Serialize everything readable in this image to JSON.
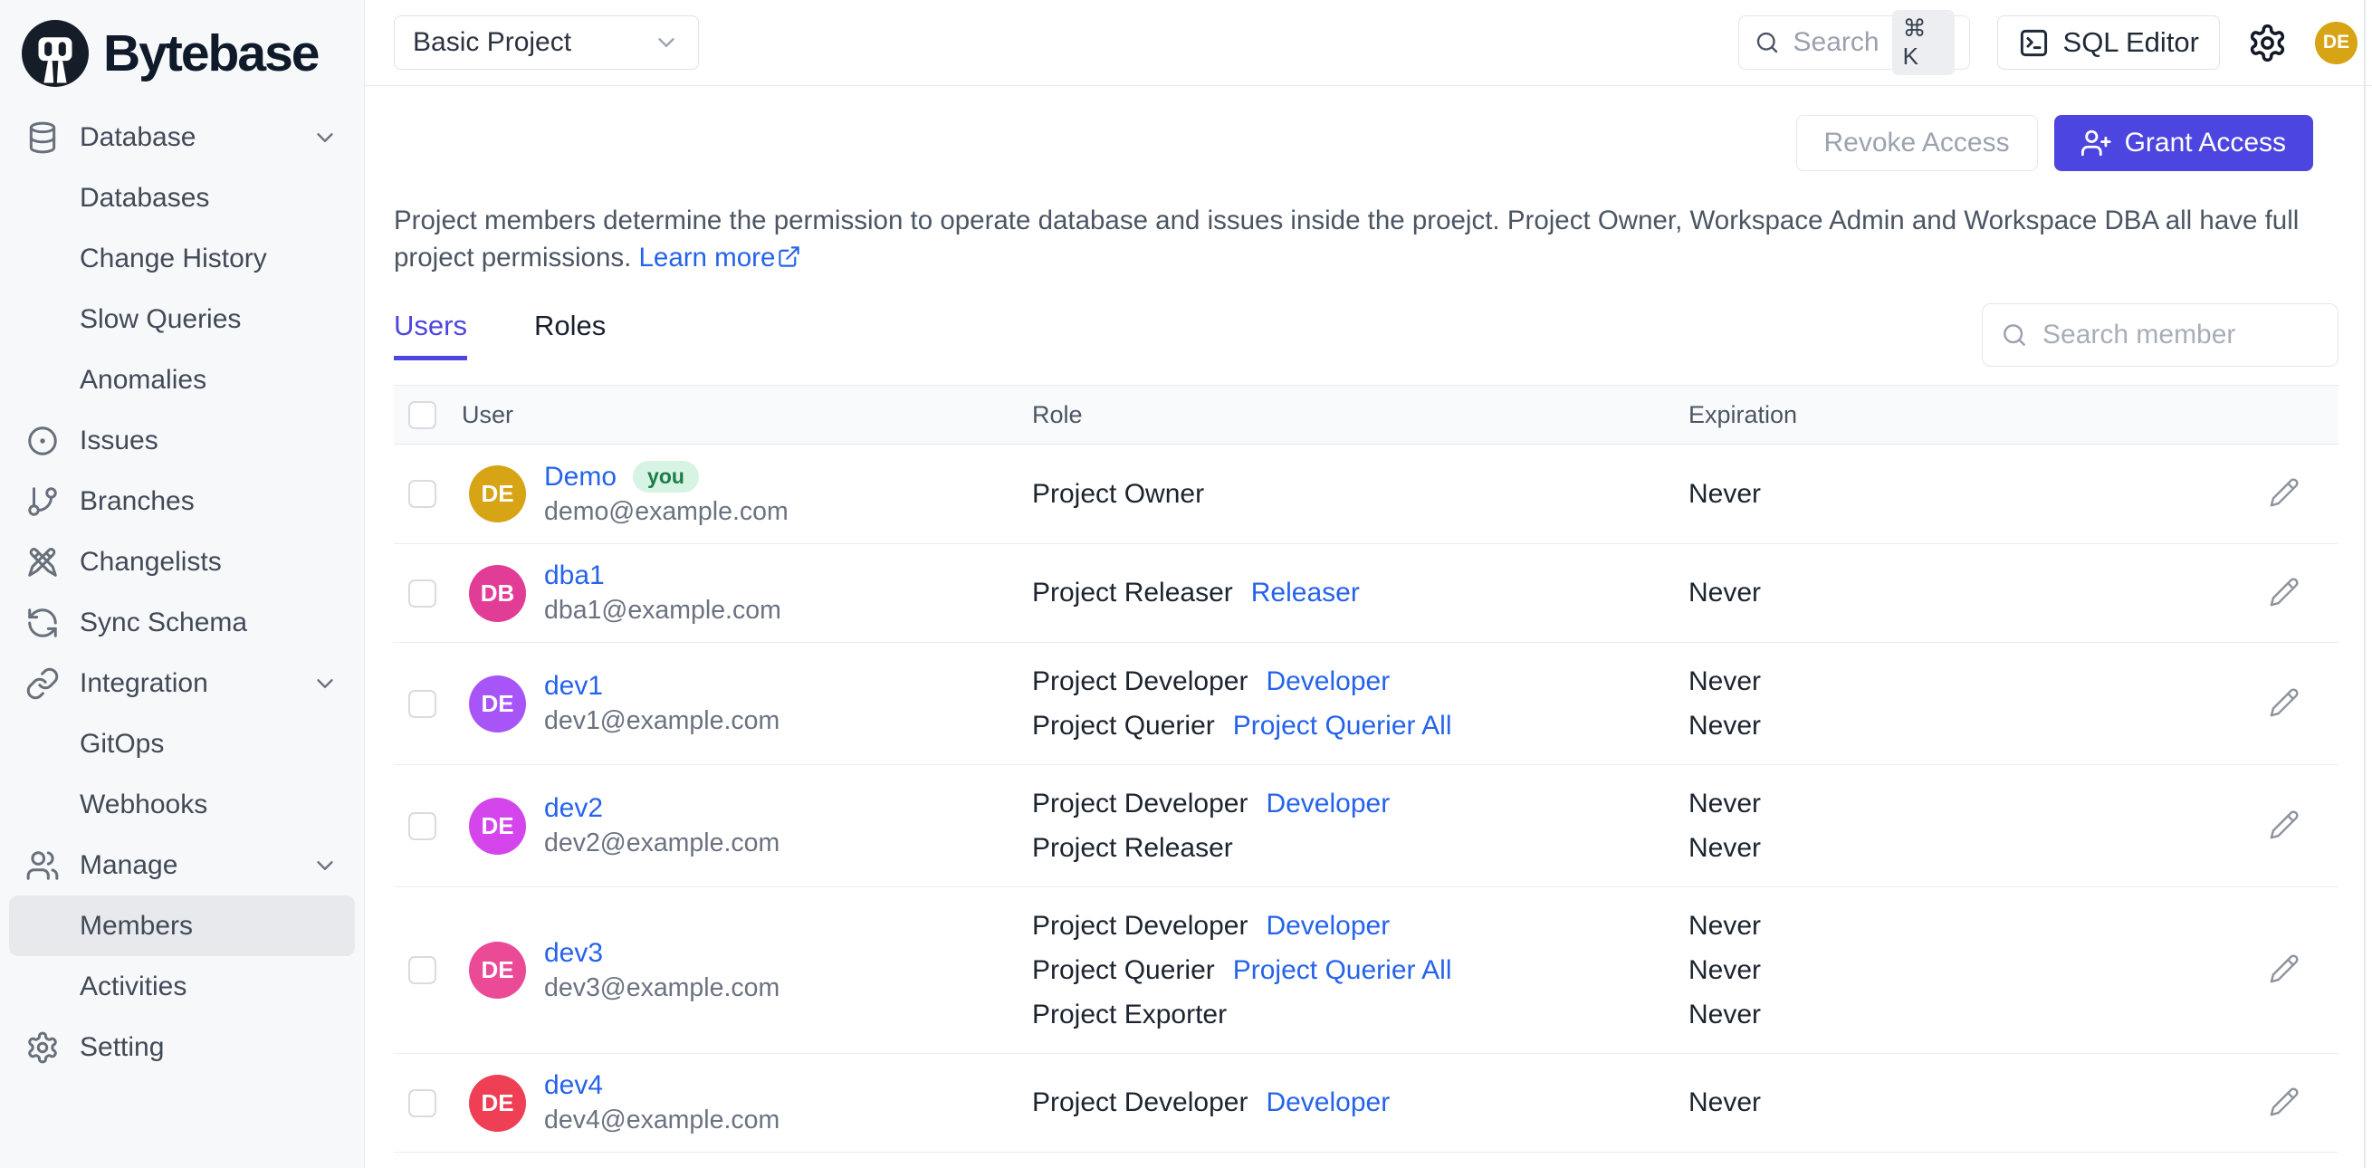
{
  "app": {
    "name": "Bytebase"
  },
  "colors": {
    "accent_indigo": "#4D45E0",
    "link_blue": "#2563eb",
    "topbar_avatar": "#D6A415",
    "sidebar_bg": "#f7f8fa",
    "badge_green_bg": "#d6f3e4",
    "badge_green_text": "#1b7d47"
  },
  "topbar": {
    "project_selector": "Basic Project",
    "search_placeholder": "Search",
    "search_shortcut": "⌘ K",
    "sql_editor_label": "SQL Editor",
    "avatar_initials": "DE"
  },
  "sidebar": {
    "items": [
      {
        "label": "Database",
        "icon": "database",
        "type": "group",
        "chevron": true
      },
      {
        "label": "Databases",
        "type": "sub"
      },
      {
        "label": "Change History",
        "type": "sub"
      },
      {
        "label": "Slow Queries",
        "type": "sub"
      },
      {
        "label": "Anomalies",
        "type": "sub"
      },
      {
        "label": "Issues",
        "icon": "issues",
        "type": "top"
      },
      {
        "label": "Branches",
        "icon": "branch",
        "type": "top"
      },
      {
        "label": "Changelists",
        "icon": "changelist",
        "type": "top"
      },
      {
        "label": "Sync Schema",
        "icon": "sync",
        "type": "top"
      },
      {
        "label": "Integration",
        "icon": "link",
        "type": "group",
        "chevron": true
      },
      {
        "label": "GitOps",
        "type": "sub"
      },
      {
        "label": "Webhooks",
        "type": "sub"
      },
      {
        "label": "Manage",
        "icon": "users",
        "type": "group",
        "chevron": true
      },
      {
        "label": "Members",
        "type": "sub",
        "active": true
      },
      {
        "label": "Activities",
        "type": "sub"
      },
      {
        "label": "Setting",
        "icon": "gear",
        "type": "top"
      }
    ]
  },
  "page": {
    "revoke_button": "Revoke Access",
    "grant_button": "Grant Access",
    "description": "Project members determine the permission to operate database and issues inside the proejct. Project Owner, Workspace Admin and Workspace DBA all have full project permissions. ",
    "learn_more": "Learn more",
    "tabs": [
      {
        "label": "Users",
        "active": true
      },
      {
        "label": "Roles",
        "active": false
      }
    ],
    "member_search_placeholder": "Search member",
    "table": {
      "columns": [
        "User",
        "Role",
        "Expiration"
      ],
      "rows": [
        {
          "name": "Demo",
          "you_badge": "you",
          "email": "demo@example.com",
          "initials": "DE",
          "avatar_color": "#D6A415",
          "roles": [
            {
              "title": "Project Owner",
              "link": "",
              "expiration": "Never"
            }
          ]
        },
        {
          "name": "dba1",
          "email": "dba1@example.com",
          "initials": "DB",
          "avatar_color": "#E23D96",
          "roles": [
            {
              "title": "Project Releaser",
              "link": "Releaser",
              "expiration": "Never"
            }
          ]
        },
        {
          "name": "dev1",
          "email": "dev1@example.com",
          "initials": "DE",
          "avatar_color": "#A855F7",
          "roles": [
            {
              "title": "Project Developer",
              "link": "Developer",
              "expiration": "Never"
            },
            {
              "title": "Project Querier",
              "link": "Project Querier All",
              "expiration": "Never"
            }
          ]
        },
        {
          "name": "dev2",
          "email": "dev2@example.com",
          "initials": "DE",
          "avatar_color": "#D446EB",
          "roles": [
            {
              "title": "Project Developer",
              "link": "Developer",
              "expiration": "Never"
            },
            {
              "title": "Project Releaser",
              "link": "",
              "expiration": "Never"
            }
          ]
        },
        {
          "name": "dev3",
          "email": "dev3@example.com",
          "initials": "DE",
          "avatar_color": "#EA4A96",
          "roles": [
            {
              "title": "Project Developer",
              "link": "Developer",
              "expiration": "Never"
            },
            {
              "title": "Project Querier",
              "link": "Project Querier All",
              "expiration": "Never"
            },
            {
              "title": "Project Exporter",
              "link": "",
              "expiration": "Never"
            }
          ]
        },
        {
          "name": "dev4",
          "email": "dev4@example.com",
          "initials": "DE",
          "avatar_color": "#EE3F55",
          "roles": [
            {
              "title": "Project Developer",
              "link": "Developer",
              "expiration": "Never"
            }
          ]
        }
      ]
    }
  }
}
